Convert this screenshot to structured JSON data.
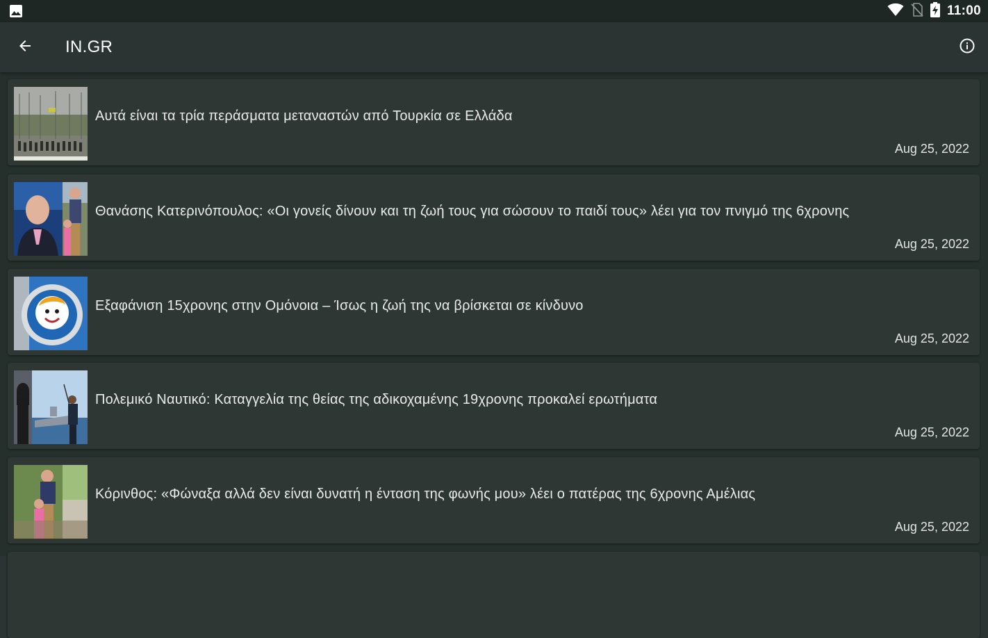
{
  "status_bar": {
    "time": "11:00",
    "icons": [
      "gallery-icon",
      "wifi-icon",
      "no-sim-icon",
      "battery-charging-icon"
    ]
  },
  "app_bar": {
    "title": "IN.GR",
    "back_icon": "arrow-back-icon",
    "info_icon": "info-icon"
  },
  "articles": [
    {
      "title": "Αυτά είναι τα τρία περάσματα μεταναστών από Τουρκία σε Ελλάδα",
      "date": "Aug 25, 2022",
      "thumbnail": "border-patrol-photo"
    },
    {
      "title": "Θανάσης Κατερινόπουλος: «Οι γονείς δίνουν και τη ζωή τους για σώσουν το παιδί τους» λέει για τον πνιγμό της 6χρονης",
      "date": "Aug 25, 2022",
      "thumbnail": "tv-guest-and-family-photo"
    },
    {
      "title": "Εξαφάνιση 15χρονης στην Ομόνοια – Ίσως η ζωή της να βρίσκεται σε κίνδυνο",
      "date": "Aug 25, 2022",
      "thumbnail": "childrens-smile-logo"
    },
    {
      "title": "Πολεμικό Ναυτικό: Καταγγελία της θείας της αδικοχαμένης 19χρονης προκαλεί ερωτήματα",
      "date": "Aug 25, 2022",
      "thumbnail": "navy-ship-photo"
    },
    {
      "title": "Κόρινθος: «Φώναξα αλλά δεν είναι δυνατή η ένταση της φωνής μου» λέει ο πατέρας της 6χρονης Αμέλιας",
      "date": "Aug 25, 2022",
      "thumbnail": "father-and-daughter-photo"
    }
  ],
  "colors": {
    "status_bar": "#1f2725",
    "app_bar": "#2b3432",
    "list_background": "#25302d",
    "card": "#2f3735",
    "text": "#e9ecea"
  }
}
